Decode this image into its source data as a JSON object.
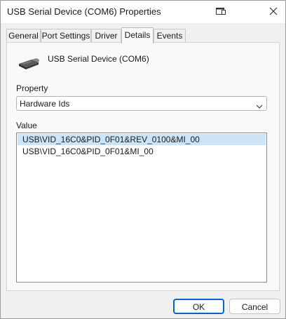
{
  "window": {
    "title": "USB Serial Device (COM6) Properties"
  },
  "tabs": [
    {
      "label": "General",
      "active": false
    },
    {
      "label": "Port Settings",
      "active": false
    },
    {
      "label": "Driver",
      "active": false
    },
    {
      "label": "Details",
      "active": true
    },
    {
      "label": "Events",
      "active": false
    }
  ],
  "details": {
    "device_name": "USB Serial Device (COM6)",
    "property_label": "Property",
    "property_selected": "Hardware Ids",
    "value_label": "Value",
    "values": [
      {
        "text": "USB\\VID_16C0&PID_0F01&REV_0100&MI_00",
        "selected": true
      },
      {
        "text": "USB\\VID_16C0&PID_0F01&MI_00",
        "selected": false
      }
    ]
  },
  "buttons": {
    "ok_label": "OK",
    "cancel_label": "Cancel"
  },
  "colors": {
    "selection": "#cce4f7",
    "default_button_border": "#0a64c8"
  },
  "icons": {
    "title_button": "window-icon",
    "close": "close-icon",
    "device": "usb-device-icon",
    "dropdown": "chevron-down-icon"
  }
}
